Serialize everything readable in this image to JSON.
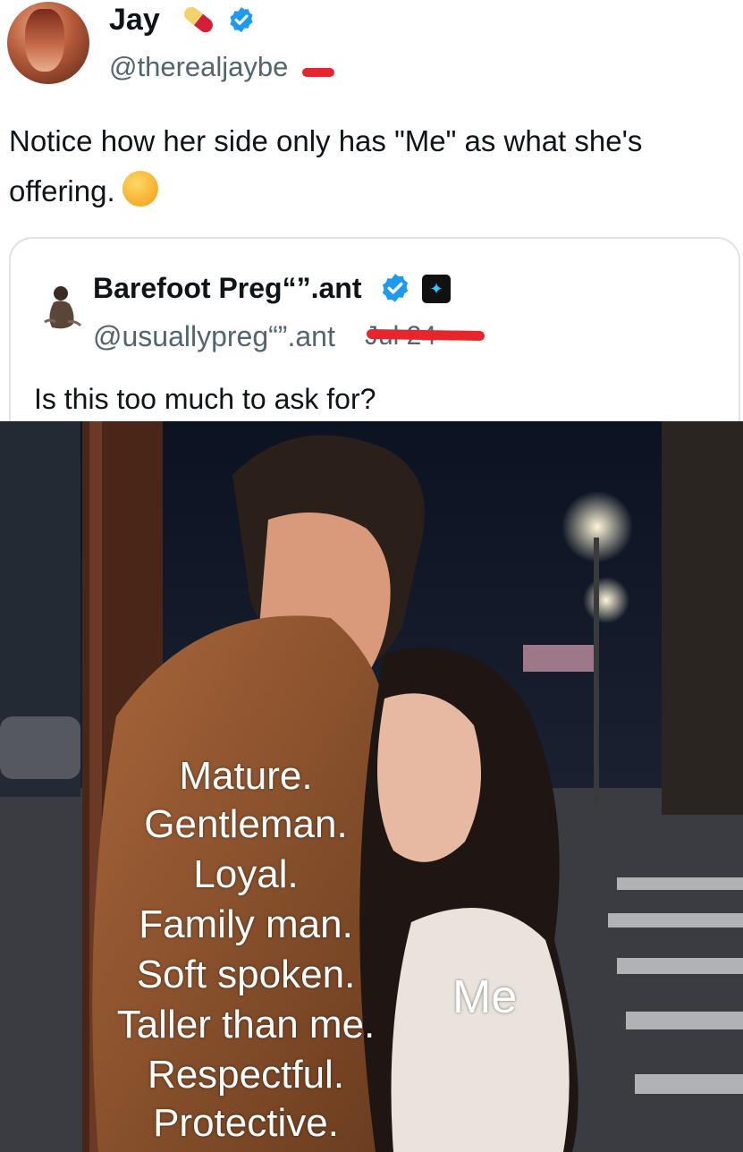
{
  "author": {
    "name": "Jay",
    "handle": "@therealjaybe",
    "verified": true
  },
  "tweet": {
    "text": "Notice how her side only has \"Me\" as what she's offering."
  },
  "quoted": {
    "name": "Barefoot Preg“”.ant",
    "handle": "@usuallypreg“”.ant",
    "date": "Jul 24",
    "text": "Is this too much to ask for?"
  },
  "image": {
    "left_list": [
      "Mature.",
      "Gentleman.",
      "Loyal.",
      "Family man.",
      "Soft spoken.",
      "Taller than me.",
      "Respectful.",
      "Protective."
    ],
    "right_label": "Me"
  },
  "icons": {
    "verified": "verified-badge-icon",
    "pill": "pill-emoji-icon",
    "thinking": "thinking-face-emoji-icon"
  },
  "colors": {
    "verified": "#1d9bf0",
    "handle": "#536471",
    "redaction": "#e8242c"
  }
}
